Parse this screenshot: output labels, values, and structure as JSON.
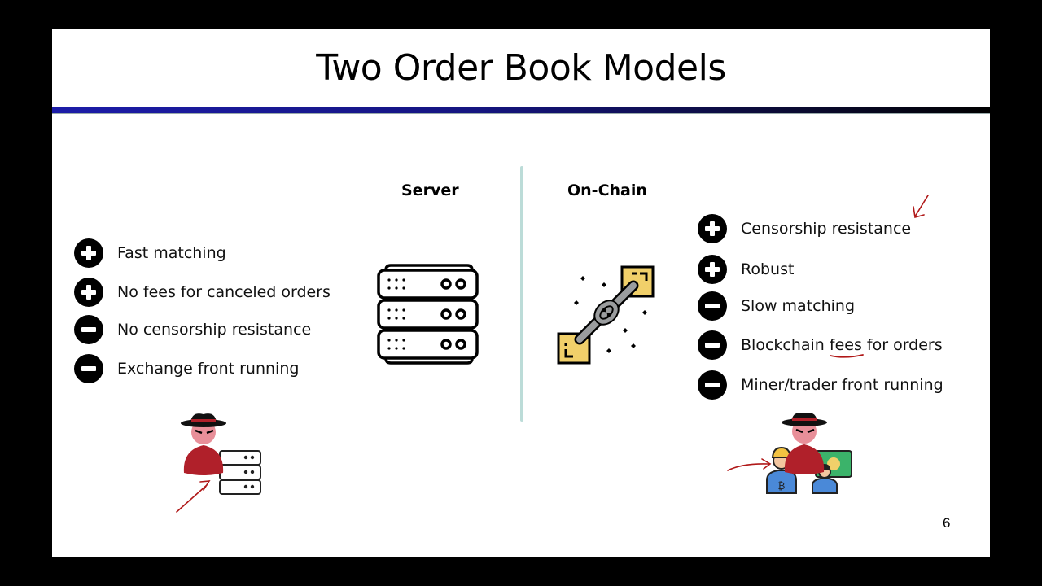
{
  "slide": {
    "title": "Two Order Book Models",
    "page_number": "6",
    "accent_colors": {
      "title_bar_start": "#1c1ca8",
      "title_bar_end": "#000000",
      "divider": "#bcdcd8",
      "annotation_ink": "#b01818",
      "block_yellow": "#f1d06a",
      "villain_red": "#b0202a"
    }
  },
  "server": {
    "heading": "Server",
    "icon": "server-rack-icon",
    "items": [
      {
        "sign": "plus",
        "icon": "plus-circle-icon",
        "text": "Fast matching"
      },
      {
        "sign": "plus",
        "icon": "plus-circle-icon",
        "text": "No fees for canceled orders"
      },
      {
        "sign": "minus",
        "icon": "minus-circle-icon",
        "text": "No censorship resistance"
      },
      {
        "sign": "minus",
        "icon": "minus-circle-icon",
        "text": "Exchange front running"
      }
    ],
    "illustration": "villain-with-server-icon"
  },
  "onchain": {
    "heading": "On-Chain",
    "icon": "blockchain-link-icon",
    "items": [
      {
        "sign": "plus",
        "icon": "plus-circle-icon",
        "text": "Censorship resistance"
      },
      {
        "sign": "plus",
        "icon": "plus-circle-icon",
        "text": "Robust"
      },
      {
        "sign": "minus",
        "icon": "minus-circle-icon",
        "text": "Slow matching"
      },
      {
        "sign": "minus",
        "icon": "minus-circle-icon",
        "text_before": "Blockchain ",
        "text_underlined": "fees",
        "text_after": " for orders"
      },
      {
        "sign": "minus",
        "icon": "minus-circle-icon",
        "text": "Miner/trader front running"
      }
    ],
    "illustration": "villain-miner-trader-icon"
  }
}
